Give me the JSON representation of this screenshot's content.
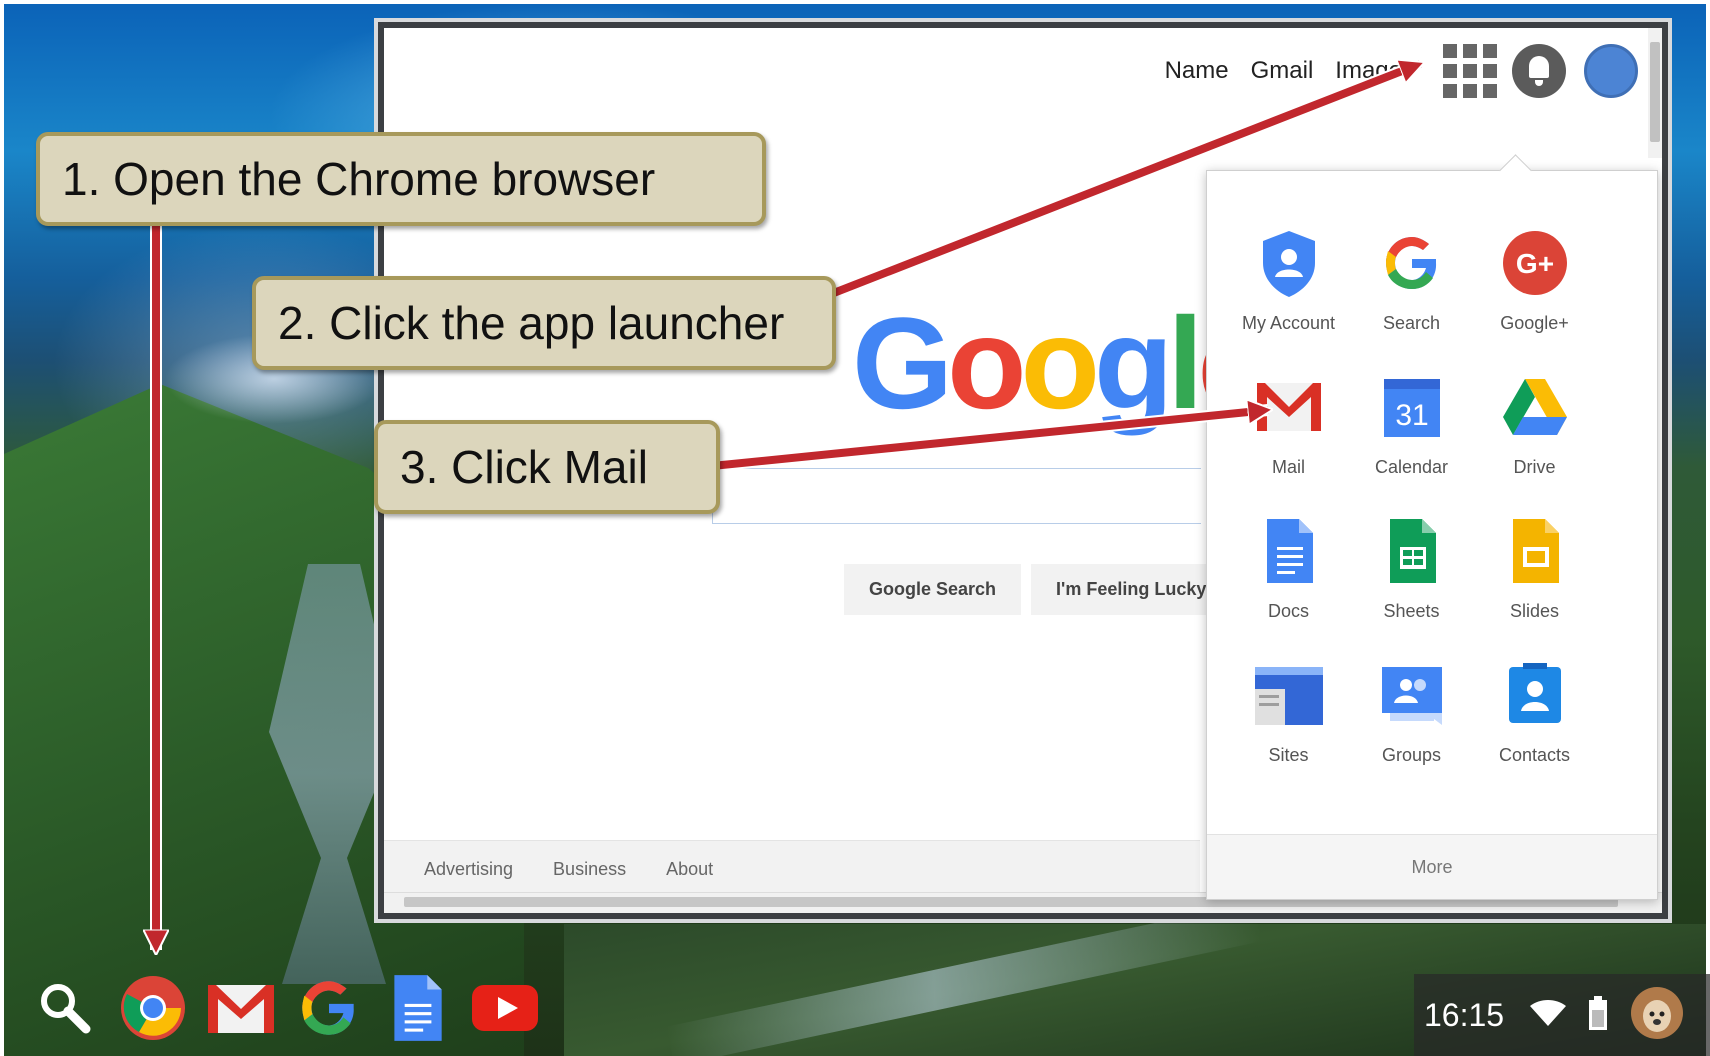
{
  "callouts": {
    "step1": "1. Open the Chrome browser",
    "step2": "2. Click the app launcher",
    "step3": "3. Click Mail"
  },
  "browser": {
    "top_nav": {
      "name": "Name",
      "gmail": "Gmail",
      "images": "Images"
    },
    "logo": "Google",
    "buttons": {
      "search": "Google Search",
      "lucky": "I'm Feeling Lucky"
    },
    "footer": {
      "advertising": "Advertising",
      "business": "Business",
      "about": "About"
    }
  },
  "app_launcher": {
    "apps": [
      {
        "label": "My Account",
        "icon": "my-account-icon"
      },
      {
        "label": "Search",
        "icon": "google-search-icon"
      },
      {
        "label": "Google+",
        "icon": "google-plus-icon"
      },
      {
        "label": "Mail",
        "icon": "gmail-icon"
      },
      {
        "label": "Calendar",
        "icon": "calendar-icon",
        "badge": "31"
      },
      {
        "label": "Drive",
        "icon": "drive-icon"
      },
      {
        "label": "Docs",
        "icon": "docs-icon"
      },
      {
        "label": "Sheets",
        "icon": "sheets-icon"
      },
      {
        "label": "Slides",
        "icon": "slides-icon"
      },
      {
        "label": "Sites",
        "icon": "sites-icon"
      },
      {
        "label": "Groups",
        "icon": "groups-icon"
      },
      {
        "label": "Contacts",
        "icon": "contacts-icon"
      }
    ],
    "more": "More"
  },
  "shelf": {
    "items": [
      "search-icon",
      "chrome-icon",
      "gmail-icon",
      "google-icon",
      "docs-icon",
      "youtube-icon"
    ]
  },
  "status": {
    "time": "16:15"
  },
  "colors": {
    "callout_bg": "#dcd6bc",
    "callout_border": "#a7995b",
    "arrow": "#c1272d",
    "google_blue": "#4285f4",
    "google_red": "#ea4335",
    "google_yellow": "#fbbc05",
    "google_green": "#34a853"
  }
}
